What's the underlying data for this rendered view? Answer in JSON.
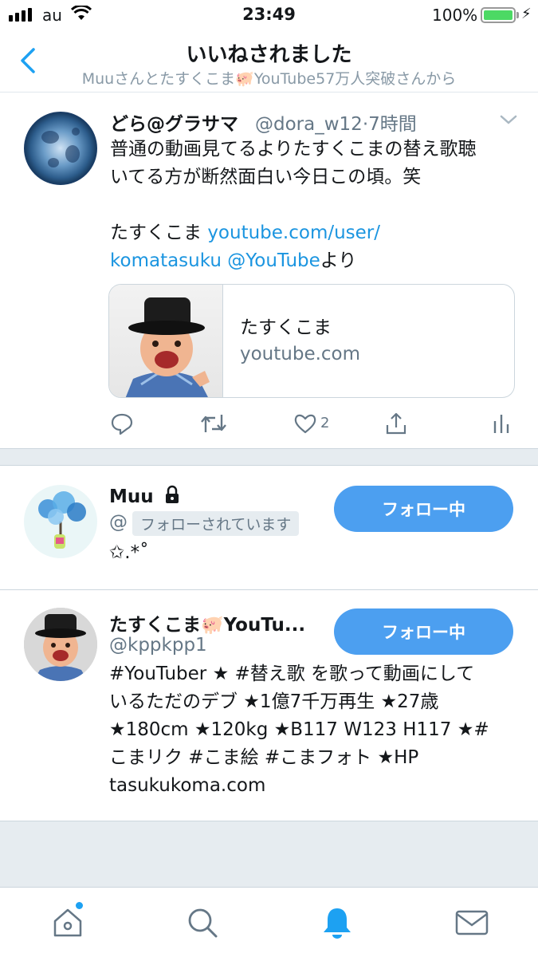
{
  "status_bar": {
    "carrier": "au",
    "time": "23:49",
    "battery_percent": "100%",
    "battery_level": 1.0
  },
  "header": {
    "title": "いいねされました",
    "subtitle": "Muuさんとたすくこま🐖YouTube57万人突破さんから"
  },
  "tweet": {
    "name": "どら@グラサマ",
    "handle": "@dora_w12",
    "time": "·7時間",
    "text_line1": "普通の動画見てるよりたすくこまの替え歌聴",
    "text_line2": "いてる方が断然面白い今日この頃。笑",
    "text_prefix": "たすくこま ",
    "link1": "youtube.com/user/",
    "link2": "komatasuku",
    "mention": "@YouTube",
    "text_suffix": "より",
    "card_title": "たすくこま",
    "card_domain": "youtube.com",
    "like_count": "2",
    "icons": [
      "reply-icon",
      "retweet-icon",
      "heart-icon",
      "share-icon",
      "analytics-icon"
    ]
  },
  "users": [
    {
      "name": "Muu",
      "handle_partial": "@",
      "follows_you": "フォローされています",
      "follow_label": "フォロー中",
      "bio": "✩.*˚"
    },
    {
      "name": "たすくこま🐖YouTu...",
      "handle": "@kppkpp1",
      "follow_label": "フォロー中",
      "bio_lines": [
        "#YouTuber ★ #替え歌 を歌って動画にして",
        "いるただのデブ ★1億7千万再生 ★27歳",
        "★180cm ★120kg ★B117 W123 H117 ★#",
        "こまリク #こま絵 #こまフォト ★HP",
        "tasukukoma.com"
      ]
    }
  ],
  "tabbar": {
    "items": [
      "home-icon",
      "search-icon",
      "notifications-icon",
      "messages-icon"
    ],
    "active": "notifications-icon",
    "accent": "#1da1f2"
  }
}
